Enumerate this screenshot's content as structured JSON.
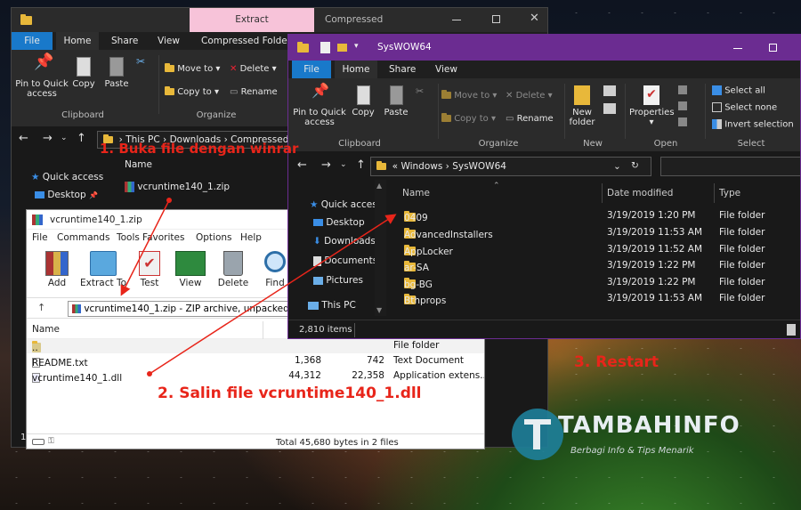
{
  "back_explorer": {
    "contextual_tab": "Extract",
    "title_tab": "Compressed",
    "tabs": [
      "File",
      "Home",
      "Share",
      "View",
      "Compressed Folder To"
    ],
    "ribbon": {
      "pin": "Pin to Quick access",
      "copy": "Copy",
      "paste": "Paste",
      "move_to": "Move to",
      "copy_to": "Copy to",
      "delete": "Delete",
      "rename": "Rename",
      "group_clipboard": "Clipboard",
      "group_organize": "Organize"
    },
    "breadcrumb": [
      "This PC",
      "Downloads",
      "Compressed"
    ],
    "nav": {
      "quick_access": "Quick access",
      "desktop": "Desktop"
    },
    "column_name": "Name",
    "file": "vcruntime140_1.zip",
    "status_count": "1"
  },
  "winrar": {
    "title": "vcruntime140_1.zip",
    "menu": [
      "File",
      "Commands",
      "Tools",
      "Favorites",
      "Options",
      "Help"
    ],
    "toolbar": [
      "Add",
      "Extract To",
      "Test",
      "View",
      "Delete",
      "Find"
    ],
    "path": "vcruntime140_1.zip - ZIP archive, unpacked size 44,312 bytes",
    "column_name": "Name",
    "rows": [
      {
        "name": "..",
        "size": "",
        "packed": "",
        "type": "File folder"
      },
      {
        "name": "README.txt",
        "size": "1,368",
        "packed": "742",
        "type": "Text Document"
      },
      {
        "name": "vcruntime140_1.dll",
        "size": "44,312",
        "packed": "22,358",
        "type": "Application extens..."
      }
    ],
    "status": "Total 45,680 bytes in 2 files"
  },
  "front_explorer": {
    "title": "SysWOW64",
    "tabs": [
      "File",
      "Home",
      "Share",
      "View"
    ],
    "ribbon": {
      "pin": "Pin to Quick access",
      "copy": "Copy",
      "paste": "Paste",
      "move_to": "Move to",
      "copy_to": "Copy to",
      "delete": "Delete",
      "rename": "Rename",
      "new_folder": "New folder",
      "properties": "Properties",
      "select_all": "Select all",
      "select_none": "Select none",
      "invert_selection": "Invert selection",
      "group_clipboard": "Clipboard",
      "group_organize": "Organize",
      "group_new": "New",
      "group_open": "Open",
      "group_select": "Select"
    },
    "breadcrumb": [
      "Windows",
      "SysWOW64"
    ],
    "nav": [
      "Quick access",
      "Desktop",
      "Downloads",
      "Documents",
      "Pictures",
      "This PC"
    ],
    "columns": {
      "name": "Name",
      "date": "Date modified",
      "type": "Type"
    },
    "rows": [
      {
        "name": "0409",
        "date": "3/19/2019 1:20 PM",
        "type": "File folder"
      },
      {
        "name": "AdvancedInstallers",
        "date": "3/19/2019 11:53 AM",
        "type": "File folder"
      },
      {
        "name": "AppLocker",
        "date": "3/19/2019 11:52 AM",
        "type": "File folder"
      },
      {
        "name": "ar-SA",
        "date": "3/19/2019 1:22 PM",
        "type": "File folder"
      },
      {
        "name": "bg-BG",
        "date": "3/19/2019 1:22 PM",
        "type": "File folder"
      },
      {
        "name": "Bthprops",
        "date": "3/19/2019 11:53 AM",
        "type": "File folder"
      }
    ],
    "status": "2,810 items"
  },
  "annotations": {
    "step1": "1. Buka file dengan winrar",
    "step2": "2. Salin file vcruntime140_1.dll",
    "step3": "3. Restart"
  },
  "brand": {
    "name": "TAMBAHINFO",
    "tagline": "Berbagi Info & Tips Menarik"
  },
  "colors": {
    "accent_blue": "#1979ca",
    "purple_title": "#6b2c91",
    "annotation_red": "#e8251a",
    "contextual_pink": "#f7c3d9"
  }
}
